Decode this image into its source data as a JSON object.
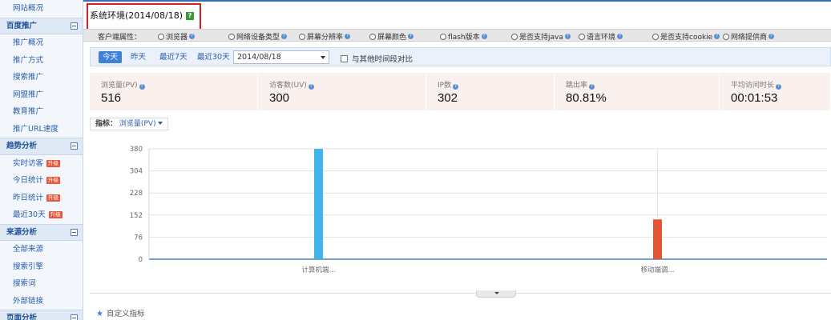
{
  "sidebar": {
    "top_item": "网站概况",
    "groups": [
      {
        "title": "百度推广",
        "items": [
          {
            "label": "推广概况",
            "hot": ""
          },
          {
            "label": "推广方式",
            "hot": ""
          },
          {
            "label": "搜索推广",
            "hot": ""
          },
          {
            "label": "网盟推广",
            "hot": ""
          },
          {
            "label": "教育推广",
            "hot": ""
          },
          {
            "label": "推广URL速度",
            "hot": ""
          }
        ]
      },
      {
        "title": "趋势分析",
        "items": [
          {
            "label": "实时访客",
            "hot": "升级"
          },
          {
            "label": "今日统计",
            "hot": "升级"
          },
          {
            "label": "昨日统计",
            "hot": "升级"
          },
          {
            "label": "最近30天",
            "hot": "升级"
          }
        ]
      },
      {
        "title": "来源分析",
        "items": [
          {
            "label": "全部来源",
            "hot": ""
          },
          {
            "label": "搜索引擎",
            "hot": ""
          },
          {
            "label": "搜索词",
            "hot": ""
          },
          {
            "label": "外部链接",
            "hot": ""
          }
        ]
      },
      {
        "title": "页面分析",
        "items": []
      }
    ]
  },
  "header": {
    "title": "系统环境(2014/08/18)",
    "help_glyph": "?"
  },
  "radio_options": [
    {
      "label": "客户端属性：",
      "is_label": true
    },
    {
      "label": "浏览器"
    },
    {
      "label": "网络设备类型"
    },
    {
      "label": "屏幕分辨率"
    },
    {
      "label": "屏幕颜色"
    },
    {
      "label": "flash版本"
    },
    {
      "label": "是否支持java"
    },
    {
      "label": "语言环境"
    },
    {
      "label": "是否支持cookie"
    },
    {
      "label": "网络提供商"
    }
  ],
  "date_bar": {
    "buttons": [
      "今天",
      "昨天",
      "最近7天",
      "最近30天"
    ],
    "active": "今天",
    "date_value": "2014/08/18",
    "compare_label": "与其他时间段对比"
  },
  "metrics": [
    {
      "label": "浏览量(PV)",
      "value": "516"
    },
    {
      "label": "访客数(UV)",
      "value": "300"
    },
    {
      "label": "IP数",
      "value": "302"
    },
    {
      "label": "跳出率",
      "value": "80.81%"
    },
    {
      "label": "平均访问时长",
      "value": "00:01:53"
    }
  ],
  "indicator": {
    "label": "指标：",
    "value": "浏览量(PV)"
  },
  "chart_data": {
    "type": "bar",
    "categories": [
      "计算机端...",
      "移动端调..."
    ],
    "values": [
      380,
      137
    ],
    "colors": [
      "#3fb5ec",
      "#e45535"
    ],
    "ylim": [
      0,
      380
    ],
    "yticks": [
      "380",
      "304",
      "228",
      "152",
      "76",
      "0"
    ],
    "grid": true
  },
  "footer": {
    "custom_metric": "自定义指标"
  }
}
